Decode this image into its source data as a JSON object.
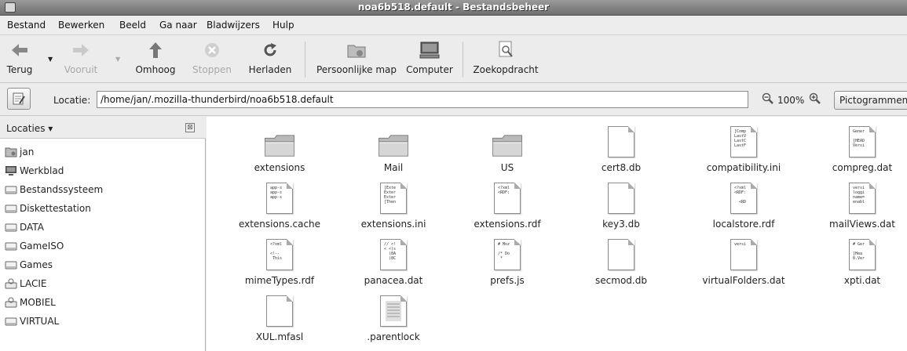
{
  "window": {
    "title": "noa6b518.default - Bestandsbeheer"
  },
  "menu": [
    "Bestand",
    "Bewerken",
    "Beeld",
    "Ga naar",
    "Bladwijzers",
    "Hulp"
  ],
  "toolbar": {
    "back": "Terug",
    "forward": "Vooruit",
    "up": "Omhoog",
    "stop": "Stoppen",
    "reload": "Herladen",
    "home": "Persoonlijke map",
    "computer": "Computer",
    "search": "Zoekopdracht"
  },
  "location": {
    "label": "Locatie:",
    "path": "/home/jan/.mozilla-thunderbird/noa6b518.default",
    "zoom": "100%",
    "view": "Pictogrammen"
  },
  "sidebar": {
    "title": "Locaties ▾",
    "close_glyph": "⊠",
    "places": [
      {
        "label": "jan",
        "icon": "home-icon"
      },
      {
        "label": "Werkblad",
        "icon": "desktop-icon"
      },
      {
        "label": "Bestandssysteem",
        "icon": "drive-icon"
      },
      {
        "label": "Diskettestation",
        "icon": "drive-icon"
      },
      {
        "label": "DATA",
        "icon": "drive-icon"
      },
      {
        "label": "GameISO",
        "icon": "drive-icon"
      },
      {
        "label": "Games",
        "icon": "drive-icon"
      },
      {
        "label": "LACIE",
        "icon": "usb-drive-icon"
      },
      {
        "label": "MOBIEL",
        "icon": "usb-drive-icon"
      },
      {
        "label": "VIRTUAL",
        "icon": "drive-icon"
      }
    ]
  },
  "files": [
    {
      "name": "extensions",
      "kind": "folder"
    },
    {
      "name": "Mail",
      "kind": "folder"
    },
    {
      "name": "US",
      "kind": "folder"
    },
    {
      "name": "cert8.db",
      "kind": "blank"
    },
    {
      "name": "compatibility.ini",
      "kind": "text",
      "preview": "[Comp\nLastV\nLastC\nLastF"
    },
    {
      "name": "compreg.dat",
      "kind": "text",
      "preview": "Gener\n\n[HEAD\nVersi"
    },
    {
      "name": "extensions.cache",
      "kind": "text",
      "preview": "app-s\napp-s\napp-s"
    },
    {
      "name": "extensions.ini",
      "kind": "text",
      "preview": "[Exte\nExter\nExter\n[Then"
    },
    {
      "name": "extensions.rdf",
      "kind": "text",
      "preview": "<?xml\n<RDF:"
    },
    {
      "name": "key3.db",
      "kind": "blank"
    },
    {
      "name": "localstore.rdf",
      "kind": "text",
      "preview": "<?xml\n<RDF:\n\n  <RD"
    },
    {
      "name": "mailViews.dat",
      "kind": "text",
      "preview": "versi\nloggi\nname=\nenabl"
    },
    {
      "name": "mimeTypes.rdf",
      "kind": "text",
      "preview": "<?xml\n\n<!--\n This"
    },
    {
      "name": "panacea.dat",
      "kind": "text",
      "preview": "// <!\n< <(s\n  (8A\n  (8C"
    },
    {
      "name": "prefs.js",
      "kind": "text",
      "preview": "# Moz\n\n/* Do\n *"
    },
    {
      "name": "secmod.db",
      "kind": "blank"
    },
    {
      "name": "virtualFolders.dat",
      "kind": "text",
      "preview": "versi"
    },
    {
      "name": "xpti.dat",
      "kind": "text",
      "preview": "# Ger\n\n[Hea\n0.Ver"
    },
    {
      "name": "XUL.mfasl",
      "kind": "blank"
    },
    {
      "name": ".parentlock",
      "kind": "lines"
    }
  ]
}
